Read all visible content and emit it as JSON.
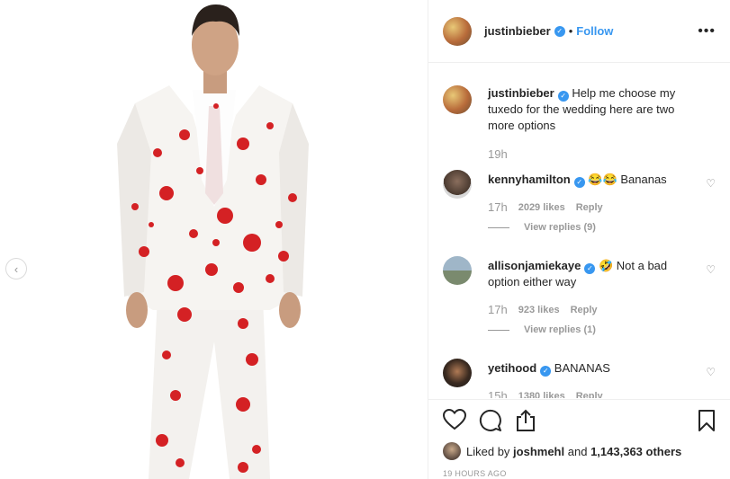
{
  "post": {
    "author": "justinbieber",
    "follow_label": "Follow",
    "separator": "•",
    "more_label": "•••",
    "caption": "Help me choose my tuxedo for the wedding here are two more options",
    "caption_time": "19h"
  },
  "comments": [
    {
      "user": "kennyhamilton",
      "text": "😂😂 Bananas",
      "time": "17h",
      "likes": "2029 likes",
      "reply": "Reply",
      "replies": "View replies (9)"
    },
    {
      "user": "allisonjamiekaye",
      "text": "🤣 Not a bad option either way",
      "time": "17h",
      "likes": "923 likes",
      "reply": "Reply",
      "replies": "View replies (1)"
    },
    {
      "user": "yetihood",
      "text": "BANANAS",
      "time": "15h",
      "likes": "1380 likes",
      "reply": "Reply"
    }
  ],
  "likes": {
    "prefix": "Liked by",
    "user": "joshmehl",
    "middle": "and",
    "count": "1,143,363 others"
  },
  "age": "19 HOURS AGO",
  "icons": {
    "prev": "‹",
    "heart_small": "♡"
  }
}
